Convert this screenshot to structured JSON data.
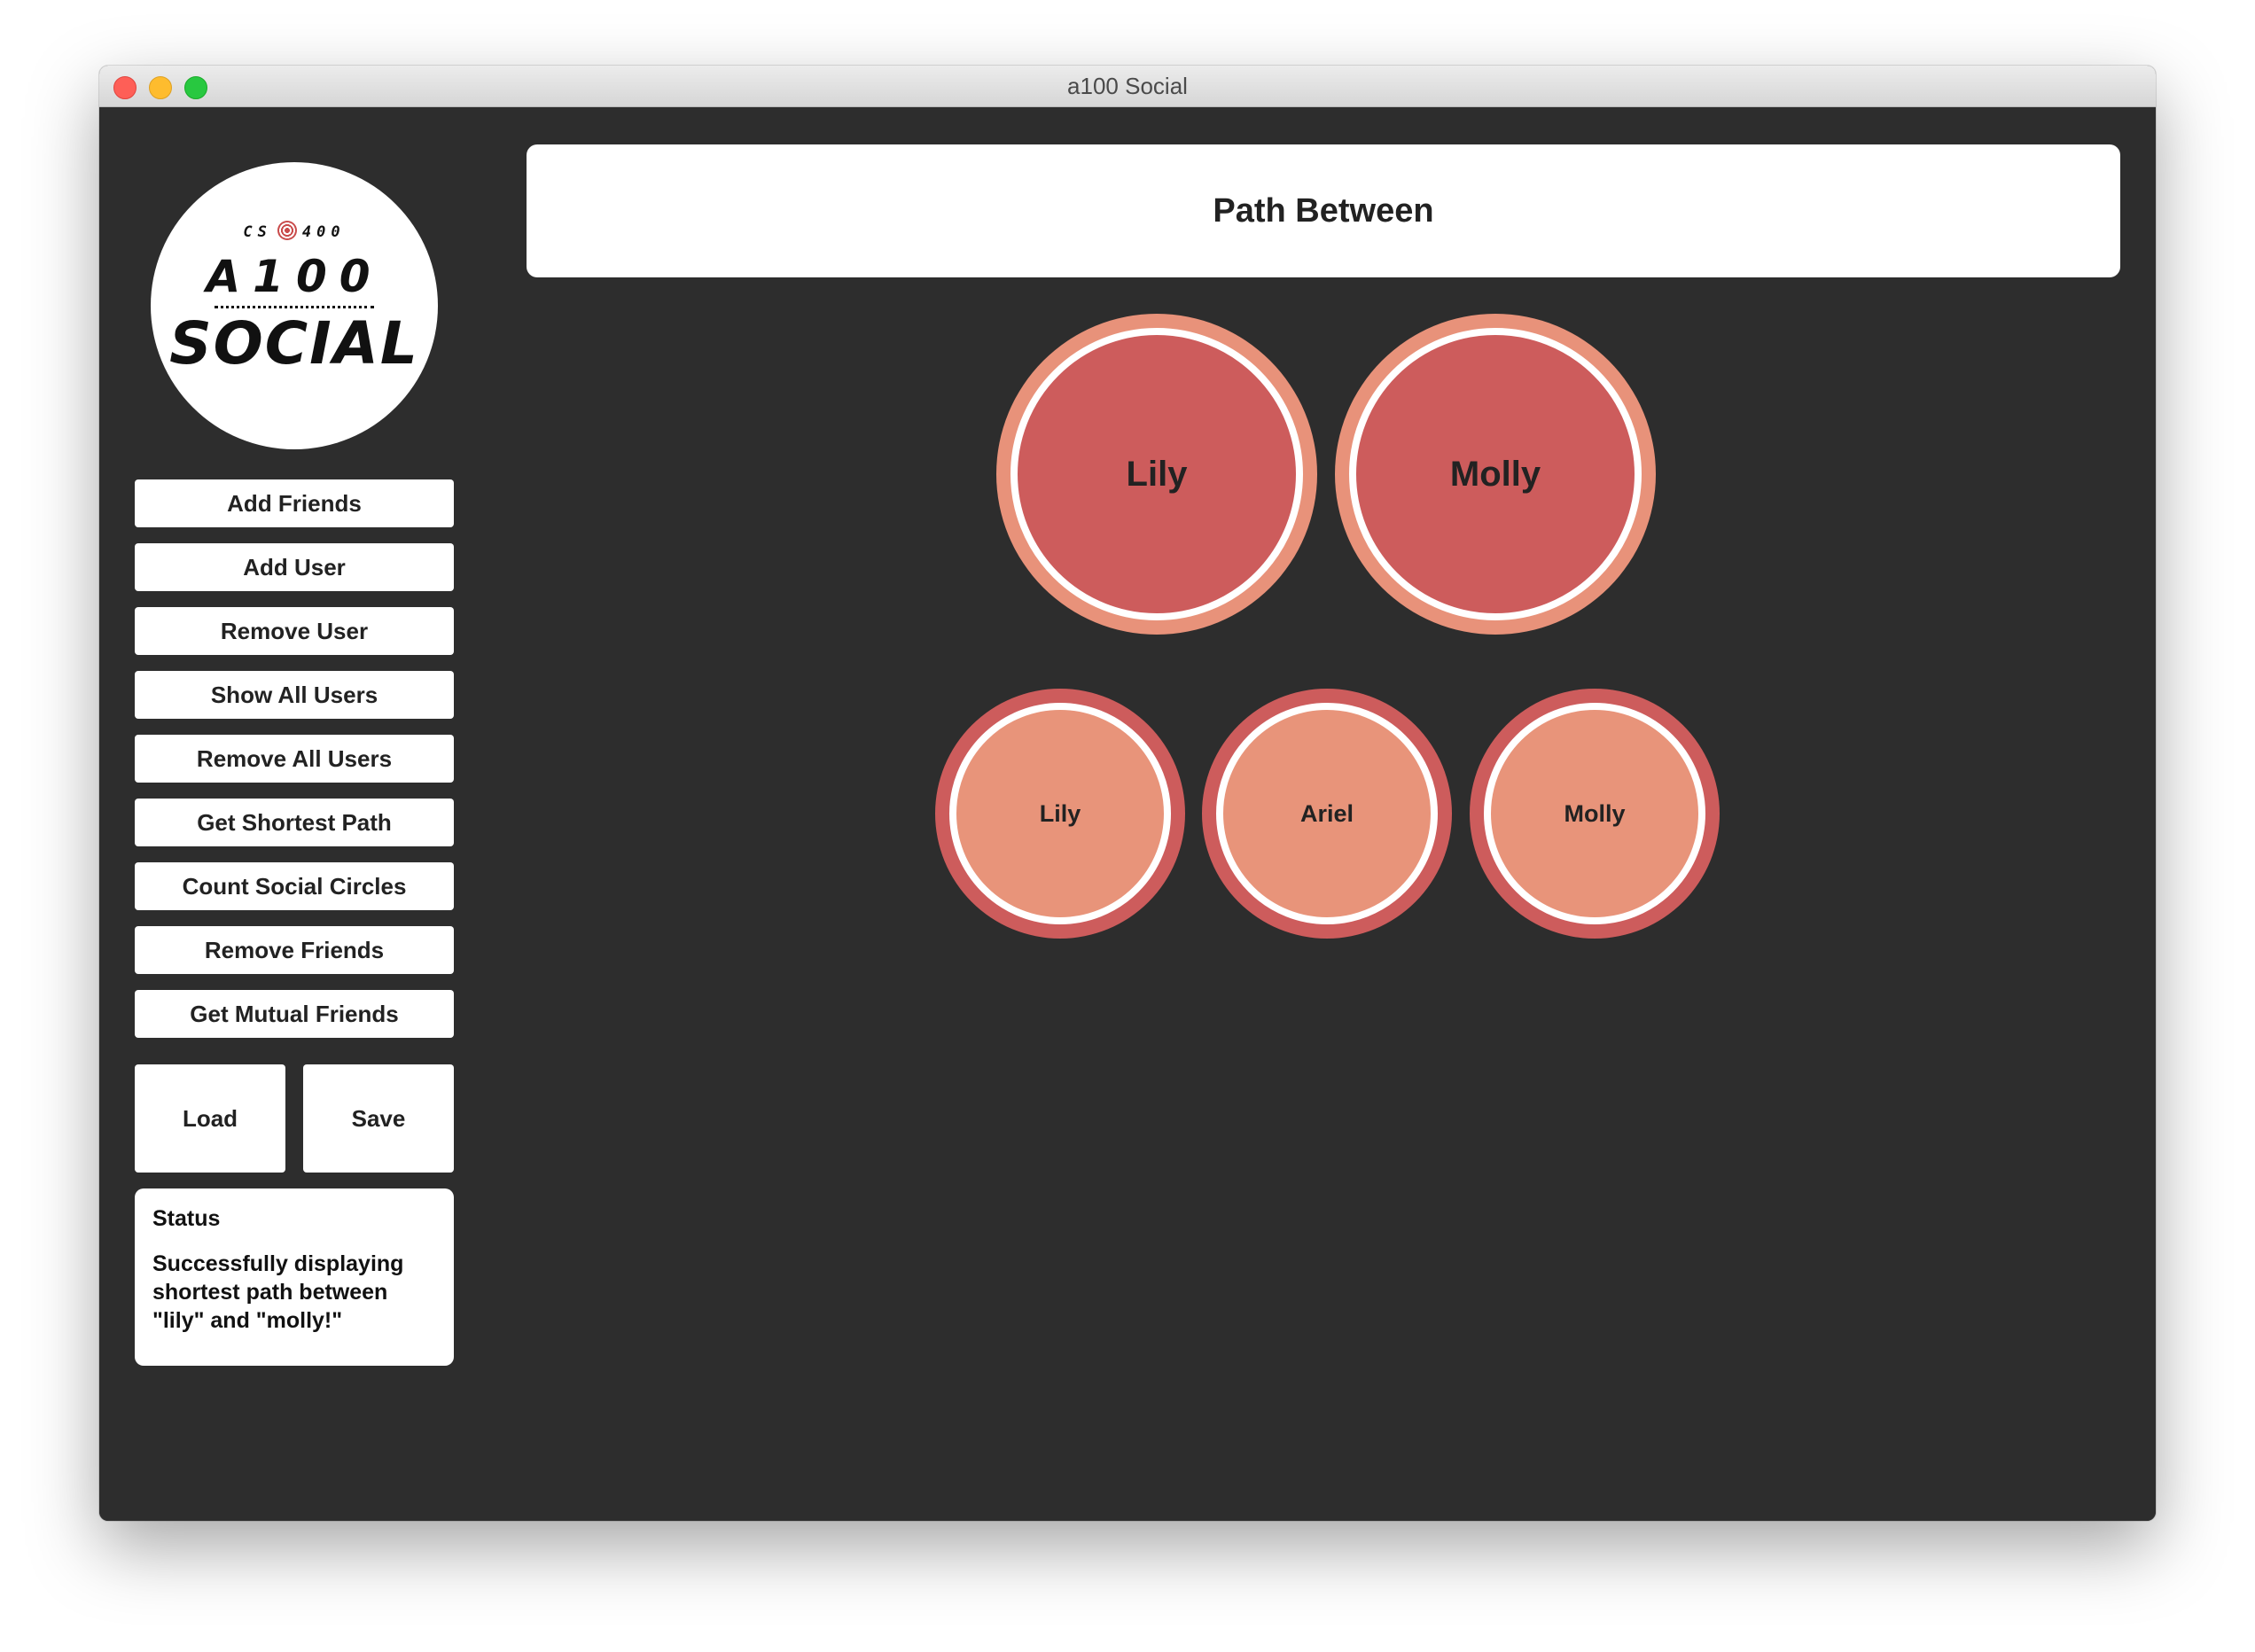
{
  "window": {
    "title": "a100 Social"
  },
  "logo": {
    "top_left": "CS",
    "top_right": "400",
    "line1": "A100",
    "line2": "SOCIAL"
  },
  "sidebar": {
    "buttons": [
      {
        "label": "Add Friends"
      },
      {
        "label": "Add User"
      },
      {
        "label": "Remove User"
      },
      {
        "label": "Show All Users"
      },
      {
        "label": "Remove All Users"
      },
      {
        "label": "Get Shortest Path"
      },
      {
        "label": "Count Social Circles"
      },
      {
        "label": "Remove Friends"
      },
      {
        "label": "Get Mutual Friends"
      }
    ],
    "load_label": "Load",
    "save_label": "Save",
    "status": {
      "title": "Status",
      "message": "Successfully displaying shortest path between \"lily\" and \"molly!\""
    }
  },
  "main": {
    "header": "Path Between",
    "endpoints": [
      {
        "name": "Lily"
      },
      {
        "name": "Molly"
      }
    ],
    "path": [
      {
        "name": "Lily"
      },
      {
        "name": "Ariel"
      },
      {
        "name": "Molly"
      }
    ]
  },
  "colors": {
    "background": "#2d2d2d",
    "node_dark": "#cd5c5c",
    "node_light": "#e8927a",
    "ring": "#ffffff"
  }
}
